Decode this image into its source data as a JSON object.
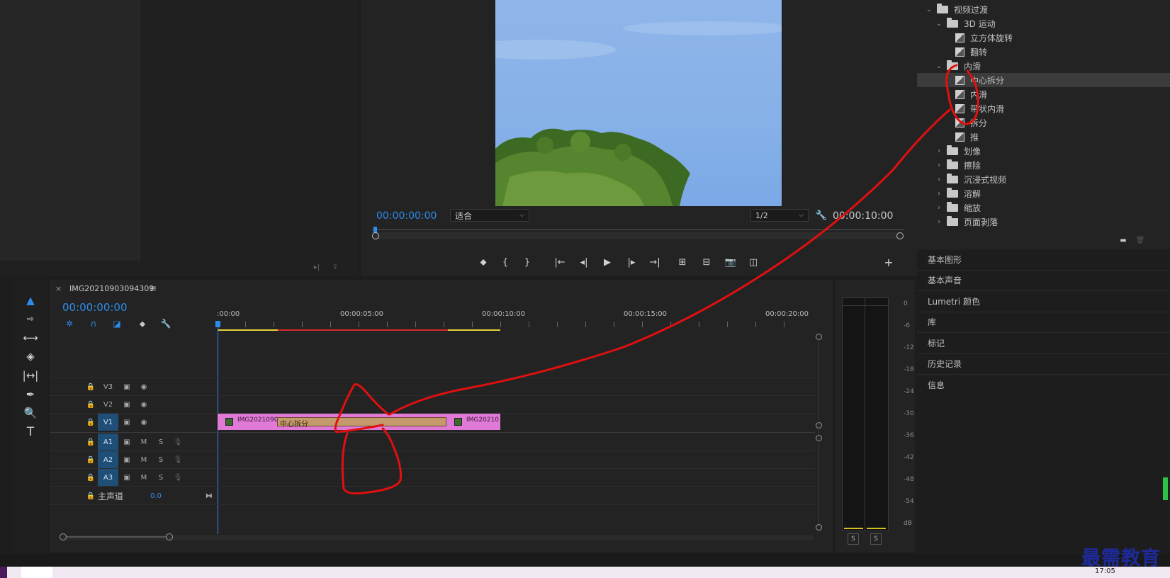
{
  "program_monitor": {
    "timecode_left": "00:00:00:00",
    "fit_select": "适合",
    "res_select": "1/2",
    "timecode_right": "00:00:10:00"
  },
  "effects": {
    "items": [
      {
        "label": "视频过渡",
        "level": 0,
        "type": "folder",
        "open": true
      },
      {
        "label": "3D 运动",
        "level": 1,
        "type": "folder",
        "open": true
      },
      {
        "label": "立方体旋转",
        "level": 2,
        "type": "fx"
      },
      {
        "label": "翻转",
        "level": 2,
        "type": "fx"
      },
      {
        "label": "内滑",
        "level": 1,
        "type": "folder",
        "open": true
      },
      {
        "label": "中心拆分",
        "level": 2,
        "type": "fx",
        "selected": true
      },
      {
        "label": "内滑",
        "level": 2,
        "type": "fx"
      },
      {
        "label": "带状内滑",
        "level": 2,
        "type": "fx"
      },
      {
        "label": "拆分",
        "level": 2,
        "type": "fx"
      },
      {
        "label": "推",
        "level": 2,
        "type": "fx"
      },
      {
        "label": "划像",
        "level": 1,
        "type": "folder",
        "open": false
      },
      {
        "label": "擦除",
        "level": 1,
        "type": "folder",
        "open": false
      },
      {
        "label": "沉浸式视频",
        "level": 1,
        "type": "folder",
        "open": false
      },
      {
        "label": "溶解",
        "level": 1,
        "type": "folder",
        "open": false
      },
      {
        "label": "缩放",
        "level": 1,
        "type": "folder",
        "open": false
      },
      {
        "label": "页面剥落",
        "level": 1,
        "type": "folder",
        "open": false
      }
    ]
  },
  "side_panels": [
    "基本图形",
    "基本声音",
    "Lumetri 颜色",
    "库",
    "标记",
    "历史记录",
    "信息"
  ],
  "timeline": {
    "close": "×",
    "sequence_name": "IMG20210903094309",
    "timecode": "00:00:00:00",
    "ruler": [
      ":00:00",
      "00:00:05:00",
      "00:00:10:00",
      "00:00:15:00",
      "00:00:20:00"
    ],
    "video_tracks": [
      "V3",
      "V2",
      "V1"
    ],
    "audio_tracks": [
      "A1",
      "A2",
      "A3"
    ],
    "mute_label": "M",
    "solo_label": "S",
    "master_label": "主声道",
    "master_value": "0.0",
    "clip_left": "IMG2021090",
    "clip_right": "IMG20210",
    "transition_label": "中心拆分"
  },
  "meter": {
    "labels": [
      "0",
      "-6",
      "-12",
      "-18",
      "-24",
      "-30",
      "-36",
      "-42",
      "-48",
      "-54",
      "dB"
    ],
    "solo_left": "S",
    "solo_right": "S"
  },
  "taskbar": {
    "time": "17:05"
  },
  "watermark": "最需教育",
  "colors": {
    "accent_blue": "#2d8ceb",
    "clip_pink": "#e07ad6",
    "transition": "#c49a6c",
    "annotation_red": "#e01010"
  }
}
